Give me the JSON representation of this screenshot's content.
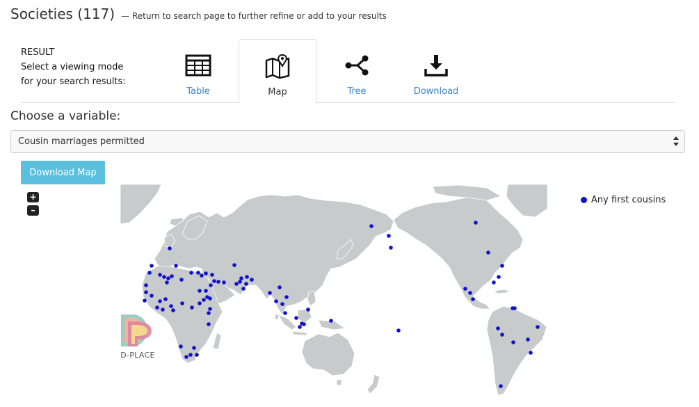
{
  "header": {
    "title": "Societies (117)",
    "subtitle": "— Return to search page to further refine or add to your results"
  },
  "result": {
    "line1": "RESULT",
    "line2": "Select a viewing mode",
    "line3": "for your search results:",
    "tabs": [
      {
        "label": "Table",
        "icon": "table-icon",
        "active": false
      },
      {
        "label": "Map",
        "icon": "map-icon",
        "active": true
      },
      {
        "label": "Tree",
        "icon": "tree-icon",
        "active": false
      },
      {
        "label": "Download",
        "icon": "download-icon",
        "active": false
      }
    ]
  },
  "variable": {
    "heading": "Choose a variable:",
    "selected": "Cousin marriages permitted"
  },
  "download_map": {
    "label": "Download Map"
  },
  "zoom": {
    "in_label": "+",
    "out_label": "–"
  },
  "legend": {
    "label": "Any first cousins",
    "color": "#1010cc"
  },
  "logo": {
    "text": "D-PLACE"
  },
  "colors": {
    "link": "#3a83c6",
    "button": "#5bc0de",
    "land": "#c8cbcc",
    "marker": "#1010cc"
  },
  "markers": [
    [
      244,
      357
    ],
    [
      218,
      382
    ],
    [
      253,
      382
    ],
    [
      215,
      392
    ],
    [
      230,
      395
    ],
    [
      236,
      398
    ],
    [
      242,
      400
    ],
    [
      247,
      397
    ],
    [
      240,
      406
    ],
    [
      261,
      402
    ],
    [
      275,
      392
    ],
    [
      285,
      392
    ],
    [
      290,
      396
    ],
    [
      296,
      393
    ],
    [
      305,
      395
    ],
    [
      314,
      405
    ],
    [
      322,
      406
    ],
    [
      337,
      381
    ],
    [
      347,
      400
    ],
    [
      355,
      398
    ],
    [
      362,
      402
    ],
    [
      340,
      408
    ],
    [
      345,
      405
    ],
    [
      354,
      408
    ],
    [
      350,
      415
    ],
    [
      303,
      410
    ],
    [
      308,
      404
    ],
    [
      210,
      410
    ],
    [
      210,
      420
    ],
    [
      218,
      425
    ],
    [
      208,
      432
    ],
    [
      230,
      433
    ],
    [
      238,
      430
    ],
    [
      226,
      442
    ],
    [
      234,
      445
    ],
    [
      246,
      440
    ],
    [
      249,
      446
    ],
    [
      262,
      436
    ],
    [
      276,
      442
    ],
    [
      287,
      436
    ],
    [
      293,
      431
    ],
    [
      298,
      427
    ],
    [
      302,
      429
    ],
    [
      296,
      418
    ],
    [
      287,
      418
    ],
    [
      302,
      444
    ],
    [
      300,
      450
    ],
    [
      300,
      466
    ],
    [
      260,
      498
    ],
    [
      279,
      500
    ],
    [
      268,
      513
    ],
    [
      274,
      510
    ],
    [
      283,
      510
    ],
    [
      388,
      421
    ],
    [
      402,
      413
    ],
    [
      397,
      433
    ],
    [
      406,
      437
    ],
    [
      410,
      450
    ],
    [
      412,
      427
    ],
    [
      426,
      457
    ],
    [
      434,
      465
    ],
    [
      437,
      466
    ],
    [
      431,
      470
    ],
    [
      443,
      445
    ],
    [
      476,
      461
    ],
    [
      534,
      325
    ],
    [
      559,
      339
    ],
    [
      562,
      356
    ],
    [
      573,
      475
    ],
    [
      669,
      415
    ],
    [
      676,
      421
    ],
    [
      680,
      430
    ],
    [
      684,
      320
    ],
    [
      702,
      363
    ],
    [
      722,
      382
    ],
    [
      717,
      398
    ],
    [
      710,
      406
    ],
    [
      737,
      443
    ],
    [
      740,
      443
    ],
    [
      716,
      472
    ],
    [
      722,
      481
    ],
    [
      738,
      492
    ],
    [
      773,
      470
    ],
    [
      759,
      488
    ],
    [
      763,
      507
    ],
    [
      720,
      555
    ]
  ]
}
